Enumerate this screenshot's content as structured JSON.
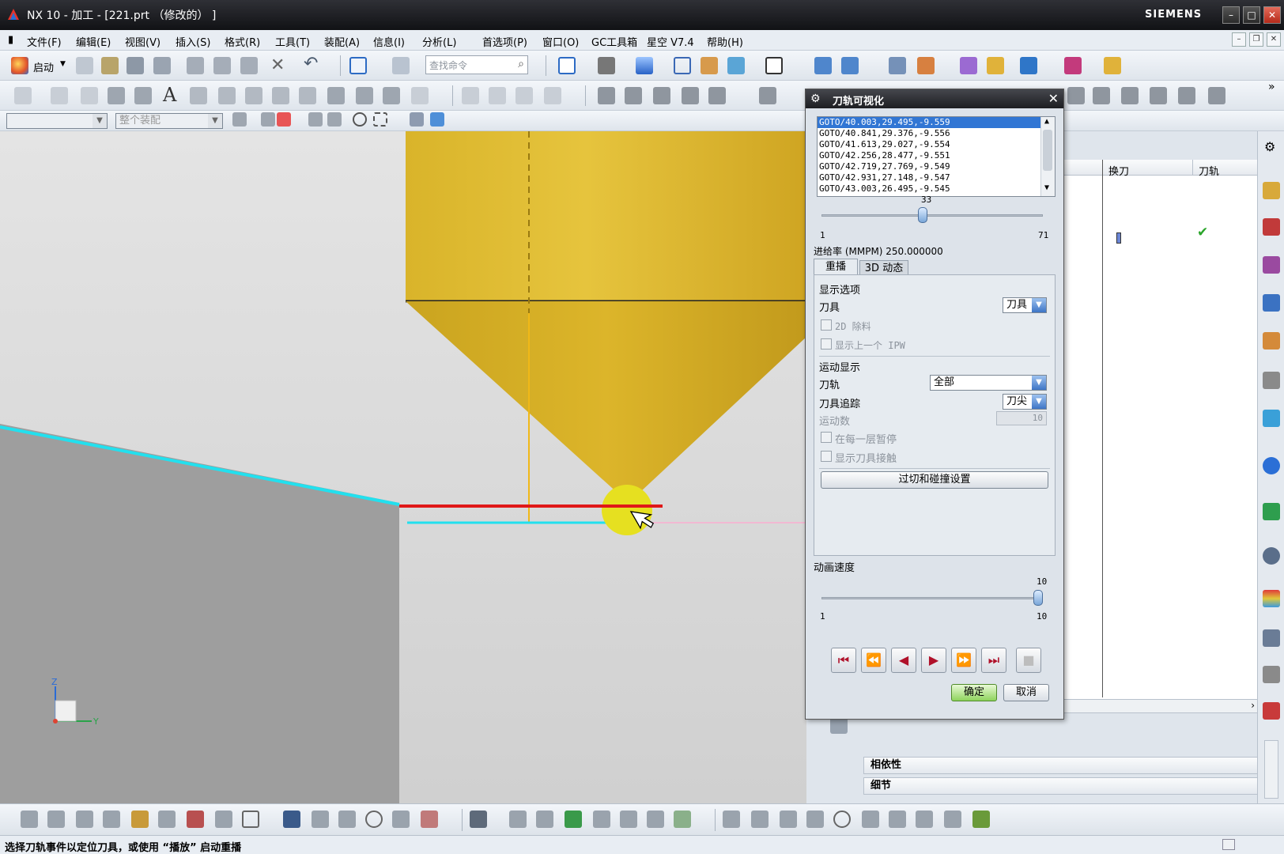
{
  "window": {
    "title": "NX 10 - 加工 - [221.prt （修改的） ]",
    "brand": "SIEMENS"
  },
  "menu": [
    "文件(F)",
    "编辑(E)",
    "视图(V)",
    "插入(S)",
    "格式(R)",
    "工具(T)",
    "装配(A)",
    "信息(I)",
    "分析(L)",
    "首选项(P)",
    "窗口(O)",
    "GC工具箱",
    "星空 V7.4",
    "帮助(H)"
  ],
  "toolbar": {
    "start_label": "启动",
    "search_placeholder": "查找命令",
    "selection_filter": "",
    "assembly_scope": "整个装配"
  },
  "dialog": {
    "title": "刀轨可视化",
    "goto_lines": [
      "GOTO/40.003,29.495,-9.559",
      "GOTO/40.841,29.376,-9.556",
      "GOTO/41.613,29.027,-9.554",
      "GOTO/42.256,28.477,-9.551",
      "GOTO/42.719,27.769,-9.549",
      "GOTO/42.931,27.148,-9.547",
      "GOTO/43.003,26.495,-9.545"
    ],
    "slider": {
      "value": "33",
      "min": "1",
      "max": "71",
      "level": 0.457
    },
    "feed_rate": "进给率 (MMPM) 250.000000",
    "tabs": [
      "重播",
      "3D 动态"
    ],
    "display_options_label": "显示选项",
    "tool_label": "刀具",
    "tool_value": "刀具",
    "option_2d_remove": "2D 除料",
    "option_show_prev_ipw": "显示上一个 IPW",
    "motion_display_label": "运动显示",
    "toolpath_label": "刀轨",
    "toolpath_value": "全部",
    "tool_trace_label": "刀具追踪",
    "tool_trace_value": "刀尖",
    "motion_count_label": "运动数",
    "motion_count_value": "10",
    "option_pause_each_level": "在每一层暂停",
    "option_show_tool_contact": "显示刀具接触",
    "gouge_button": "过切和碰撞设置",
    "anim_speed_label": "动画速度",
    "anim_speed": {
      "value": "10",
      "min": "1",
      "max": "10",
      "level": 1.0
    },
    "playback": [
      "⏮",
      "⏪",
      "◀",
      "▶",
      "⏩",
      "⏭",
      "■"
    ],
    "ok_label": "确定",
    "cancel_label": "取消"
  },
  "navigator": {
    "columns": [
      "换刀",
      "刀轨"
    ],
    "sections": [
      "相依性",
      "细节"
    ]
  },
  "status": "选择刀轨事件以定位刀具，或使用 “播放” 启动重播",
  "colors": {
    "tool": "#dcb52a",
    "toolpath_red": "#e01818",
    "toolpath_cyan": "#22e0ee",
    "accent": "#3176d4"
  },
  "axis": {
    "z": "Z",
    "y": "Y"
  }
}
